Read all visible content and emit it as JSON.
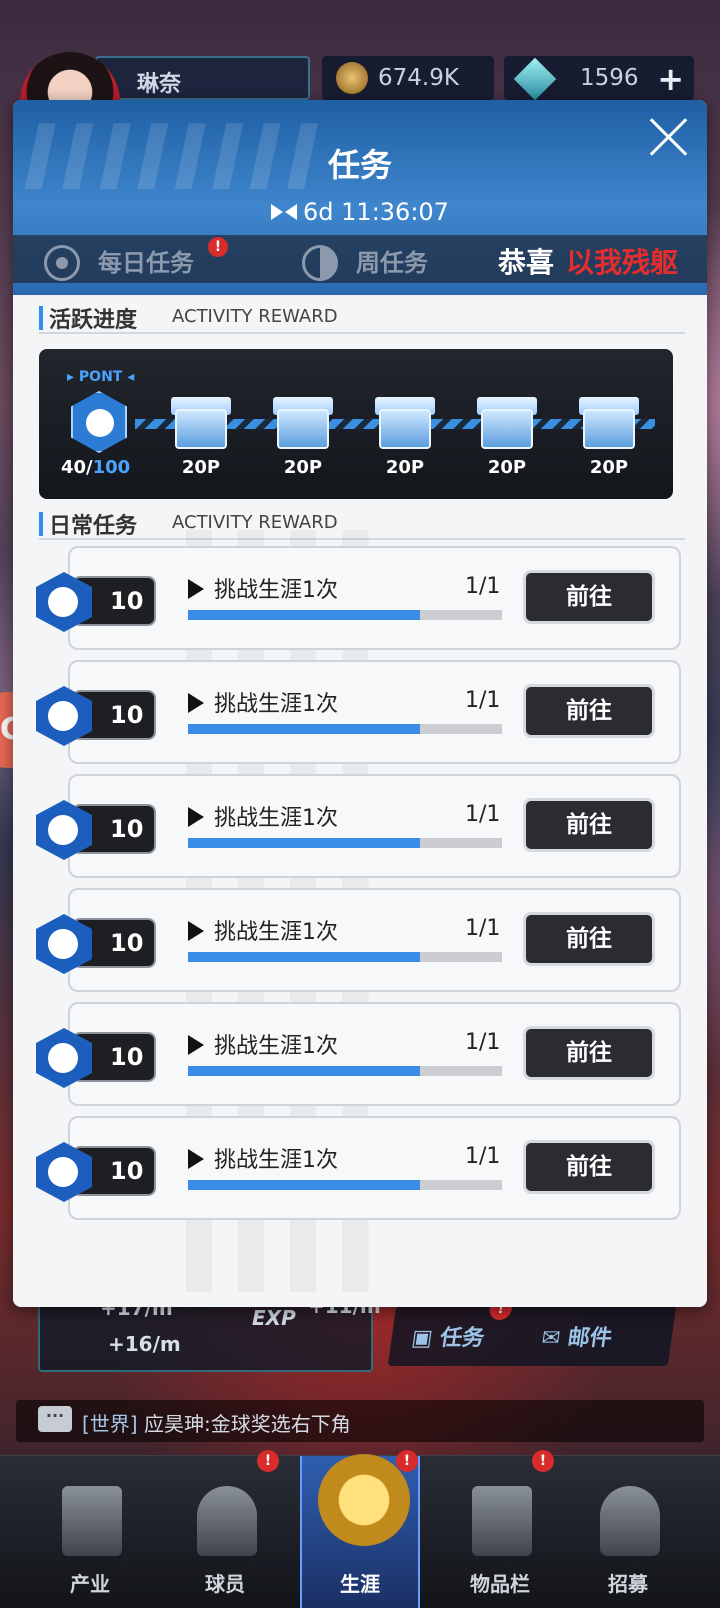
{
  "top_bar": {
    "player_name": "琳奈",
    "coins": "674.9K",
    "gems": "1596"
  },
  "modal": {
    "title": "任务",
    "timer": "6d 11:36:07",
    "tabs": [
      {
        "label": "每日任务"
      },
      {
        "label": "周任务"
      }
    ],
    "marquee": {
      "prefix": "恭喜",
      "highlight": "以我残躯"
    },
    "activity_section": {
      "title": "活跃进度",
      "subtitle": "ACTIVITY REWARD",
      "point_label": "▸ PONT ◂",
      "points_current": "40/",
      "points_max": "100",
      "progress": 0.4,
      "chests": [
        {
          "label": "20P"
        },
        {
          "label": "20P"
        },
        {
          "label": "20P"
        },
        {
          "label": "20P"
        },
        {
          "label": "20P"
        }
      ]
    },
    "daily_section": {
      "title": "日常任务",
      "subtitle": "ACTIVITY REWARD"
    },
    "tasks": [
      {
        "reward": "10",
        "title": "挑战生涯1次",
        "count": "1/1",
        "progress": 0.74,
        "button": "前往"
      },
      {
        "reward": "10",
        "title": "挑战生涯1次",
        "count": "1/1",
        "progress": 0.74,
        "button": "前往"
      },
      {
        "reward": "10",
        "title": "挑战生涯1次",
        "count": "1/1",
        "progress": 0.74,
        "button": "前往"
      },
      {
        "reward": "10",
        "title": "挑战生涯1次",
        "count": "1/1",
        "progress": 0.74,
        "button": "前往"
      },
      {
        "reward": "10",
        "title": "挑战生涯1次",
        "count": "1/1",
        "progress": 0.74,
        "button": "前往"
      },
      {
        "reward": "10",
        "title": "挑战生涯1次",
        "count": "1/1",
        "progress": 0.74,
        "button": "前往"
      }
    ]
  },
  "hud": {
    "income_1": "+17/m",
    "income_2": "+11/m",
    "income_3": "+16/m",
    "exp_tag": "EXP",
    "task_button": "任务",
    "mail_button": "邮件"
  },
  "chat": {
    "channel": "[世界]",
    "message": "应昊珅:金球奖选右下角"
  },
  "bottom_nav": [
    {
      "label": "产业"
    },
    {
      "label": "球员"
    },
    {
      "label": "生涯"
    },
    {
      "label": "物品栏"
    },
    {
      "label": "招募"
    }
  ],
  "colors": {
    "accent_blue": "#3a8de6",
    "header_blue": "#2b6ab0",
    "badge_red": "#d92b2b",
    "marquee_red": "#e52d2d"
  }
}
